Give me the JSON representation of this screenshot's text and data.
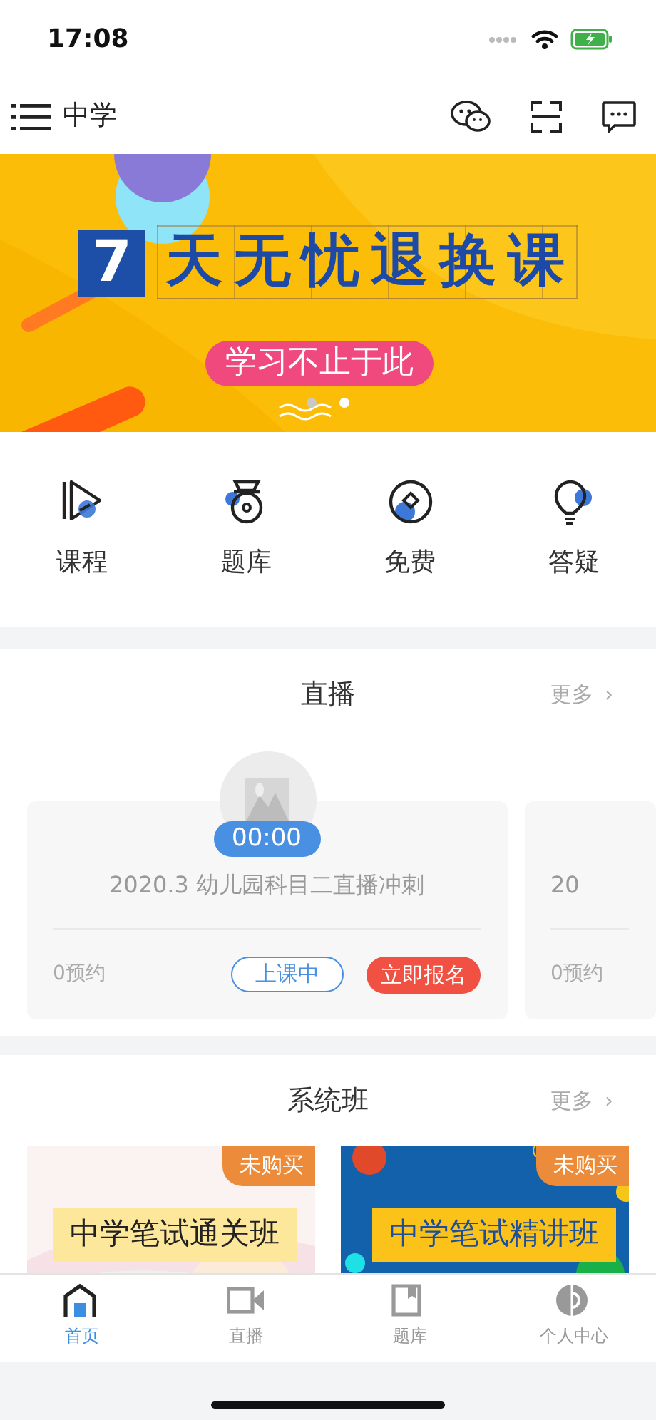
{
  "status_bar": {
    "time": "17:08"
  },
  "header": {
    "title": "中学"
  },
  "banner": {
    "badge": "7",
    "headline": "天无忧退换课",
    "slogan": "学习不止于此",
    "dots": [
      {
        "selected": false
      },
      {
        "selected": true
      }
    ]
  },
  "shortcuts": [
    {
      "label": "课程",
      "kind": "play"
    },
    {
      "label": "题库",
      "kind": "bank"
    },
    {
      "label": "免费",
      "kind": "coin"
    },
    {
      "label": "答疑",
      "kind": "bulb"
    }
  ],
  "live": {
    "title": "直播",
    "more": "更多",
    "chevron": "›",
    "cards": [
      {
        "timer": "00:00",
        "title": "2020.3 幼儿园科目二直播冲刺",
        "reservations": "0预约",
        "status": "上课中",
        "action": "立即报名"
      },
      {
        "title": "20",
        "reservations": "0预约"
      }
    ]
  },
  "classes": {
    "title": "系统班",
    "more": "更多",
    "chevron": "›",
    "items": [
      {
        "badge": "未购买",
        "name": "中学笔试通关班",
        "kind": "light"
      },
      {
        "badge": "未购买",
        "name": "中学笔试精讲班",
        "kind": "blue"
      }
    ]
  },
  "tabbar": [
    {
      "label": "首页",
      "kind": "home",
      "selected": true
    },
    {
      "label": "直播",
      "kind": "video",
      "selected": false
    },
    {
      "label": "题库",
      "kind": "book",
      "selected": false
    },
    {
      "label": "个人中心",
      "kind": "person",
      "selected": false
    }
  ]
}
